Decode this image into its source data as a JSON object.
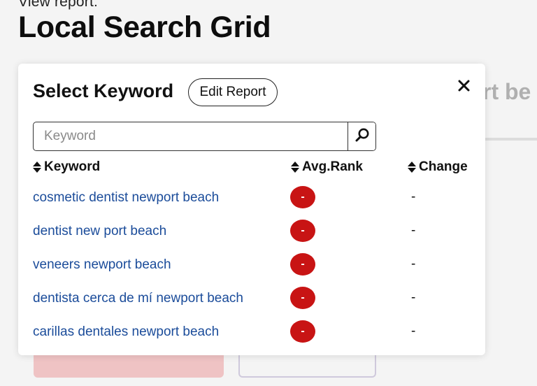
{
  "page": {
    "view_label": "View report:",
    "title": "Local Search Grid",
    "background_partial_text": "rt be"
  },
  "modal": {
    "title": "Select Keyword",
    "edit_button_label": "Edit Report",
    "close_icon": "close-icon",
    "search": {
      "placeholder": "Keyword",
      "value": "",
      "icon": "search-icon"
    },
    "columns": {
      "keyword": "Keyword",
      "avg_rank": "Avg.Rank",
      "change": "Change",
      "sort_icon": "sort-icon"
    },
    "rows": [
      {
        "keyword": "cosmetic dentist newport beach",
        "avg_rank": "-",
        "change": "-"
      },
      {
        "keyword": "dentist new port beach",
        "avg_rank": "-",
        "change": "-"
      },
      {
        "keyword": "veneers newport beach",
        "avg_rank": "-",
        "change": "-"
      },
      {
        "keyword": "dentista cerca de mí newport beach",
        "avg_rank": "-",
        "change": "-"
      },
      {
        "keyword": "carillas dentales newport beach",
        "avg_rank": "-",
        "change": "-"
      }
    ]
  },
  "colors": {
    "link": "#1b4c9a",
    "rank_badge": "#c81414",
    "page_background": "#f4f4f4"
  }
}
